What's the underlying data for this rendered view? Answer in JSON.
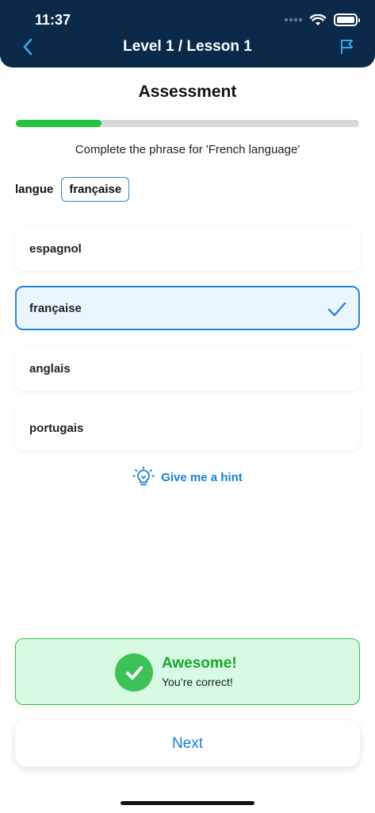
{
  "status_bar": {
    "time": "11:37"
  },
  "nav": {
    "title": "Level 1 / Lesson 1",
    "back_icon": "chevron-left-icon",
    "flag_icon": "flag-icon"
  },
  "assessment": {
    "title": "Assessment",
    "progress_fraction": 0.25,
    "prompt": "Complete the phrase for 'French language'",
    "phrase": {
      "word": "langue",
      "answer": "française"
    },
    "options": [
      {
        "label": "espagnol",
        "selected": false
      },
      {
        "label": "française",
        "selected": true
      },
      {
        "label": "anglais",
        "selected": false
      },
      {
        "label": "portugais",
        "selected": false
      }
    ],
    "hint_label": "Give me a hint"
  },
  "feedback": {
    "title": "Awesome!",
    "subtitle": "You’re correct!"
  },
  "next_label": "Next",
  "colors": {
    "header_bg": "#0b2a4a",
    "accent_blue": "#1a7fd6",
    "progress_green": "#21c43b",
    "success_green": "#3cc257",
    "feedback_bg": "#d7fbe2"
  }
}
